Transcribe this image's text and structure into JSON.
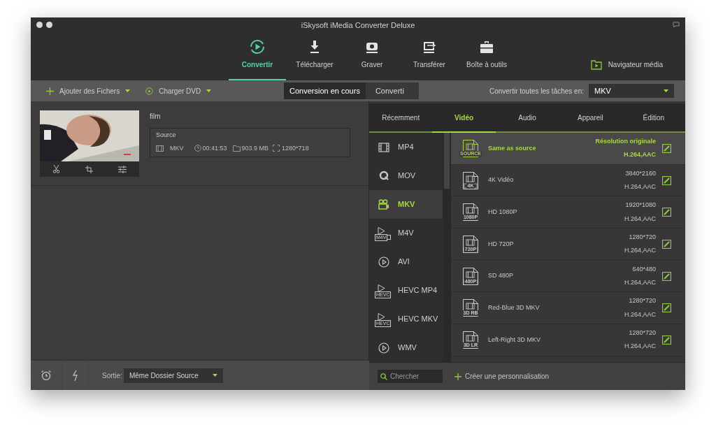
{
  "window": {
    "title": "iSkysoft iMedia Converter Deluxe"
  },
  "nav": [
    {
      "label": "Convertir",
      "selected": true
    },
    {
      "label": "Télécharger",
      "selected": false
    },
    {
      "label": "Graver",
      "selected": false
    },
    {
      "label": "Transférer",
      "selected": false
    },
    {
      "label": "Boîte à outils",
      "selected": false
    }
  ],
  "media_browser": {
    "label": "Navigateur média"
  },
  "actions": [
    {
      "label": "Ajouter des Fichers"
    },
    {
      "label": "Charger DVD"
    }
  ],
  "segments": [
    {
      "label": "Conversion en cours",
      "selected": true
    },
    {
      "label": "Converti",
      "selected": false
    }
  ],
  "convert_all": {
    "label": "Convertir toutes les tâches en:",
    "value": "MKV"
  },
  "file": {
    "name": "film",
    "source_label": "Source",
    "format": "MKV",
    "duration": "00:41:53",
    "size": "903.9 MB",
    "resolution": "1280*718"
  },
  "categories": [
    {
      "label": "Récemment",
      "selected": false
    },
    {
      "label": "Vidéo",
      "selected": true
    },
    {
      "label": "Audio",
      "selected": false
    },
    {
      "label": "Appareil",
      "selected": false
    },
    {
      "label": "Édition",
      "selected": false
    }
  ],
  "formats": [
    {
      "label": "MP4",
      "kind": "film",
      "selected": false
    },
    {
      "label": "MOV",
      "kind": "q",
      "selected": false
    },
    {
      "label": "MKV",
      "kind": "camera",
      "selected": true
    },
    {
      "label": "M4V",
      "kind": "badge",
      "badge": "M4V",
      "selected": false
    },
    {
      "label": "AVI",
      "kind": "play",
      "selected": false
    },
    {
      "label": "HEVC MP4",
      "kind": "badge",
      "badge": "HEVC",
      "selected": false
    },
    {
      "label": "HEVC MKV",
      "kind": "badge",
      "badge": "HEVC",
      "selected": false
    },
    {
      "label": "WMV",
      "kind": "play",
      "selected": false
    }
  ],
  "presets": [
    {
      "name": "Same as source",
      "badge": "SOURCE",
      "resolution": "Résolution originale",
      "codec": "H.264,AAC",
      "selected": true
    },
    {
      "name": "4K Vidéo",
      "badge": "4K",
      "resolution": "3840*2160",
      "codec": "H.264,AAC",
      "selected": false
    },
    {
      "name": "HD 1080P",
      "badge": "1080P",
      "resolution": "1920*1080",
      "codec": "H.264,AAC",
      "selected": false
    },
    {
      "name": "HD 720P",
      "badge": "720P",
      "resolution": "1280*720",
      "codec": "H.264,AAC",
      "selected": false
    },
    {
      "name": "SD 480P",
      "badge": "480P",
      "resolution": "640*480",
      "codec": "H.264,AAC",
      "selected": false
    },
    {
      "name": "Red-Blue 3D MKV",
      "badge": "3D RB",
      "resolution": "1280*720",
      "codec": "H.264,AAC",
      "selected": false
    },
    {
      "name": "Left-Right 3D MKV",
      "badge": "3D LR",
      "resolution": "1280*720",
      "codec": "H.264,AAC",
      "selected": false
    }
  ],
  "search": {
    "placeholder": "Chercher"
  },
  "create_custom": {
    "label": "Créer une personnalisation"
  },
  "output": {
    "label": "Sortie:",
    "value": "Même Dossier Source"
  }
}
